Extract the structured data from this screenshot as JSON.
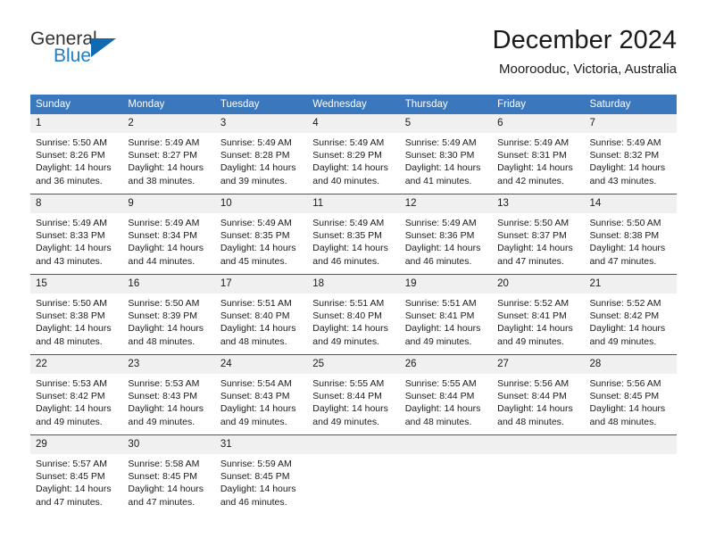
{
  "brand": {
    "name_part1": "General",
    "name_part2": "Blue",
    "triangle_color": "#1169b0",
    "blue_color": "#1f7dc4"
  },
  "header": {
    "title": "December 2024",
    "subtitle": "Moorooduc, Victoria, Australia"
  },
  "theme": {
    "header_bg": "#3b77bd",
    "row_divider": "#2a6099",
    "daynum_bg": "#f0f0f0"
  },
  "weekdays": [
    "Sunday",
    "Monday",
    "Tuesday",
    "Wednesday",
    "Thursday",
    "Friday",
    "Saturday"
  ],
  "weeks": [
    [
      {
        "day": "1",
        "sunrise": "Sunrise: 5:50 AM",
        "sunset": "Sunset: 8:26 PM",
        "daylight1": "Daylight: 14 hours",
        "daylight2": "and 36 minutes."
      },
      {
        "day": "2",
        "sunrise": "Sunrise: 5:49 AM",
        "sunset": "Sunset: 8:27 PM",
        "daylight1": "Daylight: 14 hours",
        "daylight2": "and 38 minutes."
      },
      {
        "day": "3",
        "sunrise": "Sunrise: 5:49 AM",
        "sunset": "Sunset: 8:28 PM",
        "daylight1": "Daylight: 14 hours",
        "daylight2": "and 39 minutes."
      },
      {
        "day": "4",
        "sunrise": "Sunrise: 5:49 AM",
        "sunset": "Sunset: 8:29 PM",
        "daylight1": "Daylight: 14 hours",
        "daylight2": "and 40 minutes."
      },
      {
        "day": "5",
        "sunrise": "Sunrise: 5:49 AM",
        "sunset": "Sunset: 8:30 PM",
        "daylight1": "Daylight: 14 hours",
        "daylight2": "and 41 minutes."
      },
      {
        "day": "6",
        "sunrise": "Sunrise: 5:49 AM",
        "sunset": "Sunset: 8:31 PM",
        "daylight1": "Daylight: 14 hours",
        "daylight2": "and 42 minutes."
      },
      {
        "day": "7",
        "sunrise": "Sunrise: 5:49 AM",
        "sunset": "Sunset: 8:32 PM",
        "daylight1": "Daylight: 14 hours",
        "daylight2": "and 43 minutes."
      }
    ],
    [
      {
        "day": "8",
        "sunrise": "Sunrise: 5:49 AM",
        "sunset": "Sunset: 8:33 PM",
        "daylight1": "Daylight: 14 hours",
        "daylight2": "and 43 minutes."
      },
      {
        "day": "9",
        "sunrise": "Sunrise: 5:49 AM",
        "sunset": "Sunset: 8:34 PM",
        "daylight1": "Daylight: 14 hours",
        "daylight2": "and 44 minutes."
      },
      {
        "day": "10",
        "sunrise": "Sunrise: 5:49 AM",
        "sunset": "Sunset: 8:35 PM",
        "daylight1": "Daylight: 14 hours",
        "daylight2": "and 45 minutes."
      },
      {
        "day": "11",
        "sunrise": "Sunrise: 5:49 AM",
        "sunset": "Sunset: 8:35 PM",
        "daylight1": "Daylight: 14 hours",
        "daylight2": "and 46 minutes."
      },
      {
        "day": "12",
        "sunrise": "Sunrise: 5:49 AM",
        "sunset": "Sunset: 8:36 PM",
        "daylight1": "Daylight: 14 hours",
        "daylight2": "and 46 minutes."
      },
      {
        "day": "13",
        "sunrise": "Sunrise: 5:50 AM",
        "sunset": "Sunset: 8:37 PM",
        "daylight1": "Daylight: 14 hours",
        "daylight2": "and 47 minutes."
      },
      {
        "day": "14",
        "sunrise": "Sunrise: 5:50 AM",
        "sunset": "Sunset: 8:38 PM",
        "daylight1": "Daylight: 14 hours",
        "daylight2": "and 47 minutes."
      }
    ],
    [
      {
        "day": "15",
        "sunrise": "Sunrise: 5:50 AM",
        "sunset": "Sunset: 8:38 PM",
        "daylight1": "Daylight: 14 hours",
        "daylight2": "and 48 minutes."
      },
      {
        "day": "16",
        "sunrise": "Sunrise: 5:50 AM",
        "sunset": "Sunset: 8:39 PM",
        "daylight1": "Daylight: 14 hours",
        "daylight2": "and 48 minutes."
      },
      {
        "day": "17",
        "sunrise": "Sunrise: 5:51 AM",
        "sunset": "Sunset: 8:40 PM",
        "daylight1": "Daylight: 14 hours",
        "daylight2": "and 48 minutes."
      },
      {
        "day": "18",
        "sunrise": "Sunrise: 5:51 AM",
        "sunset": "Sunset: 8:40 PM",
        "daylight1": "Daylight: 14 hours",
        "daylight2": "and 49 minutes."
      },
      {
        "day": "19",
        "sunrise": "Sunrise: 5:51 AM",
        "sunset": "Sunset: 8:41 PM",
        "daylight1": "Daylight: 14 hours",
        "daylight2": "and 49 minutes."
      },
      {
        "day": "20",
        "sunrise": "Sunrise: 5:52 AM",
        "sunset": "Sunset: 8:41 PM",
        "daylight1": "Daylight: 14 hours",
        "daylight2": "and 49 minutes."
      },
      {
        "day": "21",
        "sunrise": "Sunrise: 5:52 AM",
        "sunset": "Sunset: 8:42 PM",
        "daylight1": "Daylight: 14 hours",
        "daylight2": "and 49 minutes."
      }
    ],
    [
      {
        "day": "22",
        "sunrise": "Sunrise: 5:53 AM",
        "sunset": "Sunset: 8:42 PM",
        "daylight1": "Daylight: 14 hours",
        "daylight2": "and 49 minutes."
      },
      {
        "day": "23",
        "sunrise": "Sunrise: 5:53 AM",
        "sunset": "Sunset: 8:43 PM",
        "daylight1": "Daylight: 14 hours",
        "daylight2": "and 49 minutes."
      },
      {
        "day": "24",
        "sunrise": "Sunrise: 5:54 AM",
        "sunset": "Sunset: 8:43 PM",
        "daylight1": "Daylight: 14 hours",
        "daylight2": "and 49 minutes."
      },
      {
        "day": "25",
        "sunrise": "Sunrise: 5:55 AM",
        "sunset": "Sunset: 8:44 PM",
        "daylight1": "Daylight: 14 hours",
        "daylight2": "and 49 minutes."
      },
      {
        "day": "26",
        "sunrise": "Sunrise: 5:55 AM",
        "sunset": "Sunset: 8:44 PM",
        "daylight1": "Daylight: 14 hours",
        "daylight2": "and 48 minutes."
      },
      {
        "day": "27",
        "sunrise": "Sunrise: 5:56 AM",
        "sunset": "Sunset: 8:44 PM",
        "daylight1": "Daylight: 14 hours",
        "daylight2": "and 48 minutes."
      },
      {
        "day": "28",
        "sunrise": "Sunrise: 5:56 AM",
        "sunset": "Sunset: 8:45 PM",
        "daylight1": "Daylight: 14 hours",
        "daylight2": "and 48 minutes."
      }
    ],
    [
      {
        "day": "29",
        "sunrise": "Sunrise: 5:57 AM",
        "sunset": "Sunset: 8:45 PM",
        "daylight1": "Daylight: 14 hours",
        "daylight2": "and 47 minutes."
      },
      {
        "day": "30",
        "sunrise": "Sunrise: 5:58 AM",
        "sunset": "Sunset: 8:45 PM",
        "daylight1": "Daylight: 14 hours",
        "daylight2": "and 47 minutes."
      },
      {
        "day": "31",
        "sunrise": "Sunrise: 5:59 AM",
        "sunset": "Sunset: 8:45 PM",
        "daylight1": "Daylight: 14 hours",
        "daylight2": "and 46 minutes."
      },
      {
        "day": "",
        "sunrise": "",
        "sunset": "",
        "daylight1": "",
        "daylight2": ""
      },
      {
        "day": "",
        "sunrise": "",
        "sunset": "",
        "daylight1": "",
        "daylight2": ""
      },
      {
        "day": "",
        "sunrise": "",
        "sunset": "",
        "daylight1": "",
        "daylight2": ""
      },
      {
        "day": "",
        "sunrise": "",
        "sunset": "",
        "daylight1": "",
        "daylight2": ""
      }
    ]
  ]
}
